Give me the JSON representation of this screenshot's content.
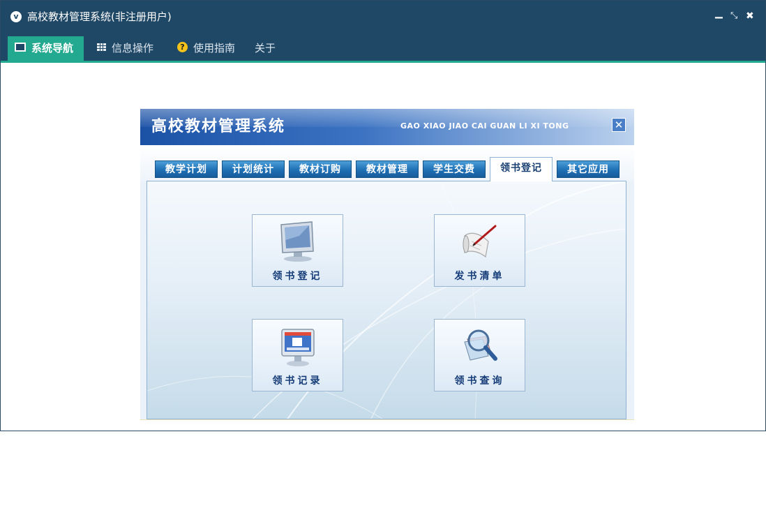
{
  "window": {
    "title": "高校教材管理系统(非注册用户)",
    "logo_icon": "app-logo-icon",
    "controls": [
      "minimize-icon",
      "restore-icon",
      "close-icon"
    ]
  },
  "menu": {
    "items": [
      {
        "label": "系统导航",
        "icon": "monitor-icon",
        "active": true
      },
      {
        "label": "信息操作",
        "icon": "grid-icon",
        "active": false
      },
      {
        "label": "使用指南",
        "icon": "help-icon",
        "active": false
      },
      {
        "label": "关于",
        "icon": "",
        "active": false
      }
    ]
  },
  "panel": {
    "title": "高校教材管理系统",
    "subtitle": "GAO XIAO JIAO CAI GUAN LI XI TONG",
    "tabs": [
      {
        "label": "教学计划",
        "active": false
      },
      {
        "label": "计划统计",
        "active": false
      },
      {
        "label": "教材订购",
        "active": false
      },
      {
        "label": "教材管理",
        "active": false
      },
      {
        "label": "学生交费",
        "active": false
      },
      {
        "label": "领书登记",
        "active": true
      },
      {
        "label": "其它应用",
        "active": false
      }
    ],
    "buttons": [
      {
        "label": "领书登记",
        "icon": "computer-monitor-icon"
      },
      {
        "label": "发书清单",
        "icon": "scroll-pen-icon"
      },
      {
        "label": "领书记录",
        "icon": "monitor-window-icon"
      },
      {
        "label": "领书查询",
        "icon": "magnifier-icon"
      }
    ]
  },
  "colors": {
    "title_bar": "#1f4766",
    "active_menu": "#22a98f",
    "panel_header": "#1c52a6",
    "tab": "#1e6fb5",
    "button_label": "#153c78"
  }
}
